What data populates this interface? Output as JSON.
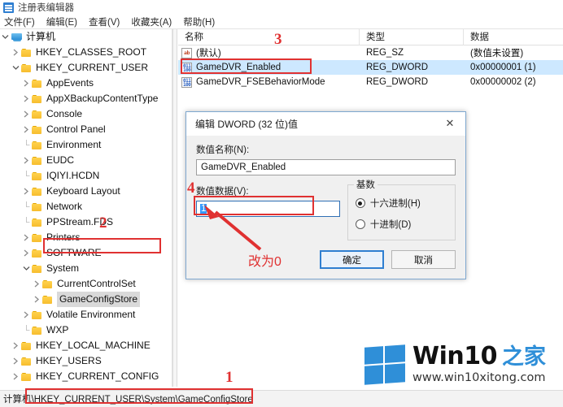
{
  "window": {
    "title": "注册表编辑器",
    "icon": "registry-editor-icon"
  },
  "menubar": {
    "items": [
      {
        "label": "文件(F)"
      },
      {
        "label": "编辑(E)"
      },
      {
        "label": "查看(V)"
      },
      {
        "label": "收藏夹(A)"
      },
      {
        "label": "帮助(H)"
      }
    ]
  },
  "tree": {
    "nodes": [
      {
        "label": "计算机",
        "indent": 0,
        "icon": "computer-icon",
        "expander": "expanded",
        "selected": false
      },
      {
        "label": "HKEY_CLASSES_ROOT",
        "indent": 1,
        "icon": "folder-icon",
        "expander": "collapsed",
        "selected": false
      },
      {
        "label": "HKEY_CURRENT_USER",
        "indent": 1,
        "icon": "folder-icon",
        "expander": "expanded",
        "selected": false
      },
      {
        "label": "AppEvents",
        "indent": 2,
        "icon": "folder-icon",
        "expander": "collapsed",
        "selected": false
      },
      {
        "label": "AppXBackupContentType",
        "indent": 2,
        "icon": "folder-icon",
        "expander": "collapsed",
        "selected": false
      },
      {
        "label": "Console",
        "indent": 2,
        "icon": "folder-icon",
        "expander": "collapsed",
        "selected": false
      },
      {
        "label": "Control Panel",
        "indent": 2,
        "icon": "folder-icon",
        "expander": "collapsed",
        "selected": false
      },
      {
        "label": "Environment",
        "indent": 2,
        "icon": "folder-icon",
        "expander": "leaf",
        "selected": false
      },
      {
        "label": "EUDC",
        "indent": 2,
        "icon": "folder-icon",
        "expander": "collapsed",
        "selected": false
      },
      {
        "label": "IQIYI.HCDN",
        "indent": 2,
        "icon": "folder-icon",
        "expander": "leaf",
        "selected": false
      },
      {
        "label": "Keyboard Layout",
        "indent": 2,
        "icon": "folder-icon",
        "expander": "collapsed",
        "selected": false
      },
      {
        "label": "Network",
        "indent": 2,
        "icon": "folder-icon",
        "expander": "leaf",
        "selected": false
      },
      {
        "label": "PPStream.FDS",
        "indent": 2,
        "icon": "folder-icon",
        "expander": "leaf",
        "selected": false
      },
      {
        "label": "Printers",
        "indent": 2,
        "icon": "folder-icon",
        "expander": "collapsed",
        "selected": false
      },
      {
        "label": "SOFTWARE",
        "indent": 2,
        "icon": "folder-icon",
        "expander": "collapsed",
        "selected": false
      },
      {
        "label": "System",
        "indent": 2,
        "icon": "folder-icon",
        "expander": "expanded",
        "selected": false
      },
      {
        "label": "CurrentControlSet",
        "indent": 3,
        "icon": "folder-icon",
        "expander": "collapsed",
        "selected": false
      },
      {
        "label": "GameConfigStore",
        "indent": 3,
        "icon": "folder-icon",
        "expander": "collapsed",
        "selected": true
      },
      {
        "label": "Volatile Environment",
        "indent": 2,
        "icon": "folder-icon",
        "expander": "collapsed",
        "selected": false
      },
      {
        "label": "WXP",
        "indent": 2,
        "icon": "folder-icon",
        "expander": "leaf",
        "selected": false
      },
      {
        "label": "HKEY_LOCAL_MACHINE",
        "indent": 1,
        "icon": "folder-icon",
        "expander": "collapsed",
        "selected": false
      },
      {
        "label": "HKEY_USERS",
        "indent": 1,
        "icon": "folder-icon",
        "expander": "collapsed",
        "selected": false
      },
      {
        "label": "HKEY_CURRENT_CONFIG",
        "indent": 1,
        "icon": "folder-icon",
        "expander": "collapsed",
        "selected": false
      }
    ]
  },
  "list": {
    "columns": [
      {
        "label": "名称"
      },
      {
        "label": "类型"
      },
      {
        "label": "数据"
      }
    ],
    "rows": [
      {
        "name": "(默认)",
        "type": "REG_SZ",
        "data": "(数值未设置)",
        "icon": "string-value-icon",
        "selected": false
      },
      {
        "name": "GameDVR_Enabled",
        "type": "REG_DWORD",
        "data": "0x00000001 (1)",
        "icon": "dword-value-icon",
        "selected": true
      },
      {
        "name": "GameDVR_FSEBehaviorMode",
        "type": "REG_DWORD",
        "data": "0x00000002 (2)",
        "icon": "dword-value-icon",
        "selected": false
      }
    ]
  },
  "dialog": {
    "title": "编辑 DWORD (32 位)值",
    "close_icon": "close-icon",
    "name_label": "数值名称(N):",
    "name_value": "GameDVR_Enabled",
    "data_label": "数值数据(V):",
    "data_value": "1",
    "base_group_label": "基数",
    "radios": [
      {
        "label": "十六进制(H)",
        "checked": true
      },
      {
        "label": "十进制(D)",
        "checked": false
      }
    ],
    "ok_label": "确定",
    "cancel_label": "取消"
  },
  "statusbar": {
    "path": "计算机\\HKEY_CURRENT_USER\\System\\GameConfigStore"
  },
  "annotations": {
    "step1": "1",
    "step2": "2",
    "step3": "3",
    "step4": "4",
    "note": "改为0",
    "color": "#e03131"
  },
  "watermark": {
    "brand": "Win10",
    "brand_suffix": "之家",
    "url": "www.win10xitong.com",
    "logo_icon": "windows-logo-icon",
    "accent": "#2f8fd8"
  }
}
